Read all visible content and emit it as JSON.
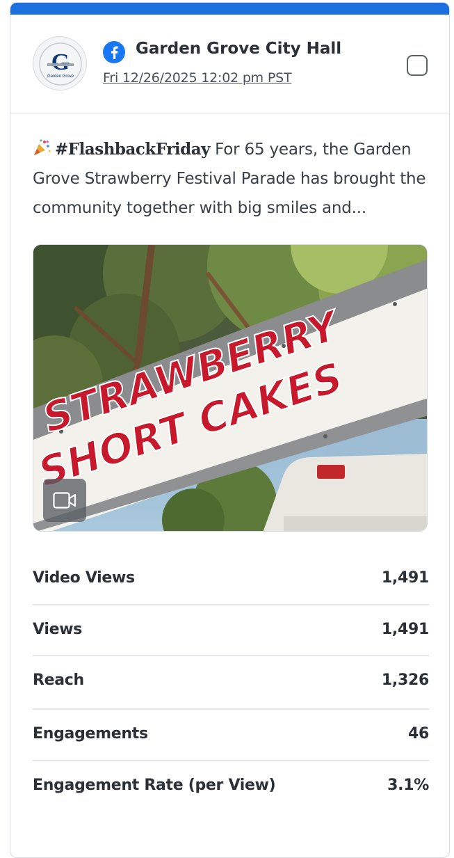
{
  "post": {
    "account_name": "Garden Grove City Hall",
    "platform_icon": "facebook-icon",
    "date": "Fri 12/26/2025 12:02 pm PST",
    "avatar_text": "G",
    "avatar_subtext": "Garden Grove",
    "caption_hashtag": "#FlashbackFriday",
    "caption_text": "For 65 years, the Garden Grove Strawberry Festival Parade has brought the community together with big smiles and...",
    "media_type_icon": "video-camera-icon",
    "media_sign_line1": "STRAWBERRY",
    "media_sign_line2": "SHORT CAKES"
  },
  "metrics": [
    {
      "label": "Video Views",
      "value": "1,491"
    },
    {
      "label": "Views",
      "value": "1,491"
    },
    {
      "label": "Reach",
      "value": "1,326"
    },
    {
      "label": "Engagements",
      "value": "46"
    },
    {
      "label": "Engagement Rate (per View)",
      "value": "3.1%"
    }
  ],
  "colors": {
    "accent": "#1b6fde",
    "facebook": "#1877f2",
    "sign_text": "#c8182c"
  }
}
